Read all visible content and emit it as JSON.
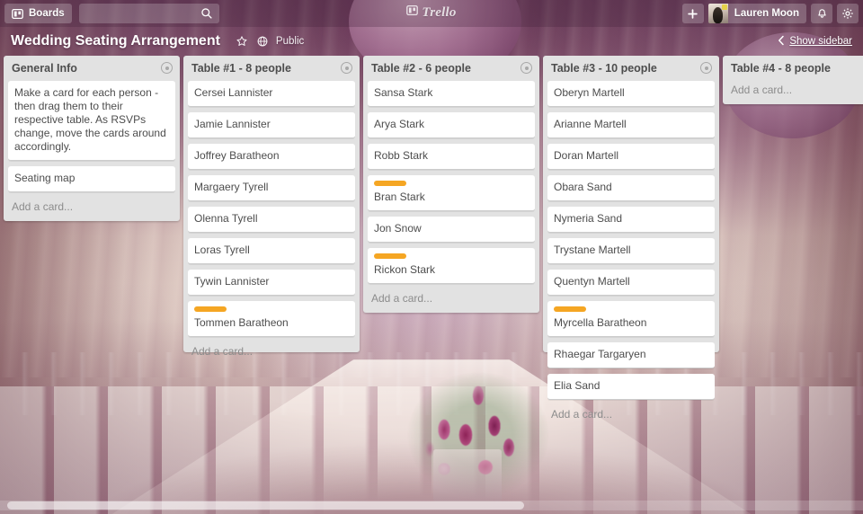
{
  "header": {
    "boards_button": "Boards",
    "boards_icon": "board-icon",
    "search_placeholder": "",
    "search_value": "",
    "search_icon": "search-icon",
    "logo_text": "Trello",
    "logo_icon": "trello-board-icon",
    "add_button": "+",
    "member_name": "Lauren Moon",
    "avatar_alt": "avatar",
    "notifications_icon": "bell-icon",
    "settings_icon": "gear-icon"
  },
  "board": {
    "title": "Wedding Seating Arrangement",
    "star_icon": "star-icon",
    "globe_icon": "globe-icon",
    "visibility": "Public",
    "show_sidebar": "Show sidebar",
    "show_sidebar_icon": "chevron-left-icon"
  },
  "colors": {
    "label_orange": "#f5a623",
    "list_background": "#e2e2e2",
    "card_background": "#ffffff",
    "text": "#4d4d4d"
  },
  "add_card_text": "Add a card...",
  "lists": [
    {
      "title": "General Info",
      "menu_icon": "list-menu-icon",
      "add_card": "Add a card...",
      "cards": [
        {
          "text": "Make a card for each person - then drag them to their respective table. As RSVPs change, move the cards around accordingly.",
          "label": null
        },
        {
          "text": "Seating map",
          "label": null
        }
      ]
    },
    {
      "title": "Table #1 - 8 people",
      "menu_icon": "list-menu-icon",
      "add_card": "Add a card...",
      "cards": [
        {
          "text": "Cersei Lannister",
          "label": null
        },
        {
          "text": "Jamie Lannister",
          "label": null
        },
        {
          "text": "Joffrey Baratheon",
          "label": null
        },
        {
          "text": "Margaery Tyrell",
          "label": null
        },
        {
          "text": "Olenna Tyrell",
          "label": null
        },
        {
          "text": "Loras Tyrell",
          "label": null
        },
        {
          "text": "Tywin Lannister",
          "label": null
        },
        {
          "text": "Tommen Baratheon",
          "label": "#f5a623"
        }
      ]
    },
    {
      "title": "Table #2 - 6 people",
      "menu_icon": "list-menu-icon",
      "add_card": "Add a card...",
      "cards": [
        {
          "text": "Sansa Stark",
          "label": null
        },
        {
          "text": "Arya Stark",
          "label": null
        },
        {
          "text": "Robb Stark",
          "label": null
        },
        {
          "text": "Bran Stark",
          "label": "#f5a623"
        },
        {
          "text": "Jon Snow",
          "label": null
        },
        {
          "text": "Rickon Stark",
          "label": "#f5a623"
        }
      ]
    },
    {
      "title": "Table #3 - 10 people",
      "menu_icon": "list-menu-icon",
      "add_card": "Add a card...",
      "cards": [
        {
          "text": "Oberyn Martell",
          "label": null
        },
        {
          "text": "Arianne Martell",
          "label": null
        },
        {
          "text": "Doran Martell",
          "label": null
        },
        {
          "text": "Obara Sand",
          "label": null
        },
        {
          "text": "Nymeria Sand",
          "label": null
        },
        {
          "text": "Trystane Martell",
          "label": null
        },
        {
          "text": "Quentyn Martell",
          "label": null
        },
        {
          "text": "Myrcella Baratheon",
          "label": "#f5a623"
        },
        {
          "text": "Rhaegar Targaryen",
          "label": null
        },
        {
          "text": "Elia Sand",
          "label": null
        }
      ]
    },
    {
      "title": "Table #4 - 8 people",
      "menu_icon": "list-menu-icon",
      "add_card": "Add a card...",
      "cards": []
    }
  ]
}
